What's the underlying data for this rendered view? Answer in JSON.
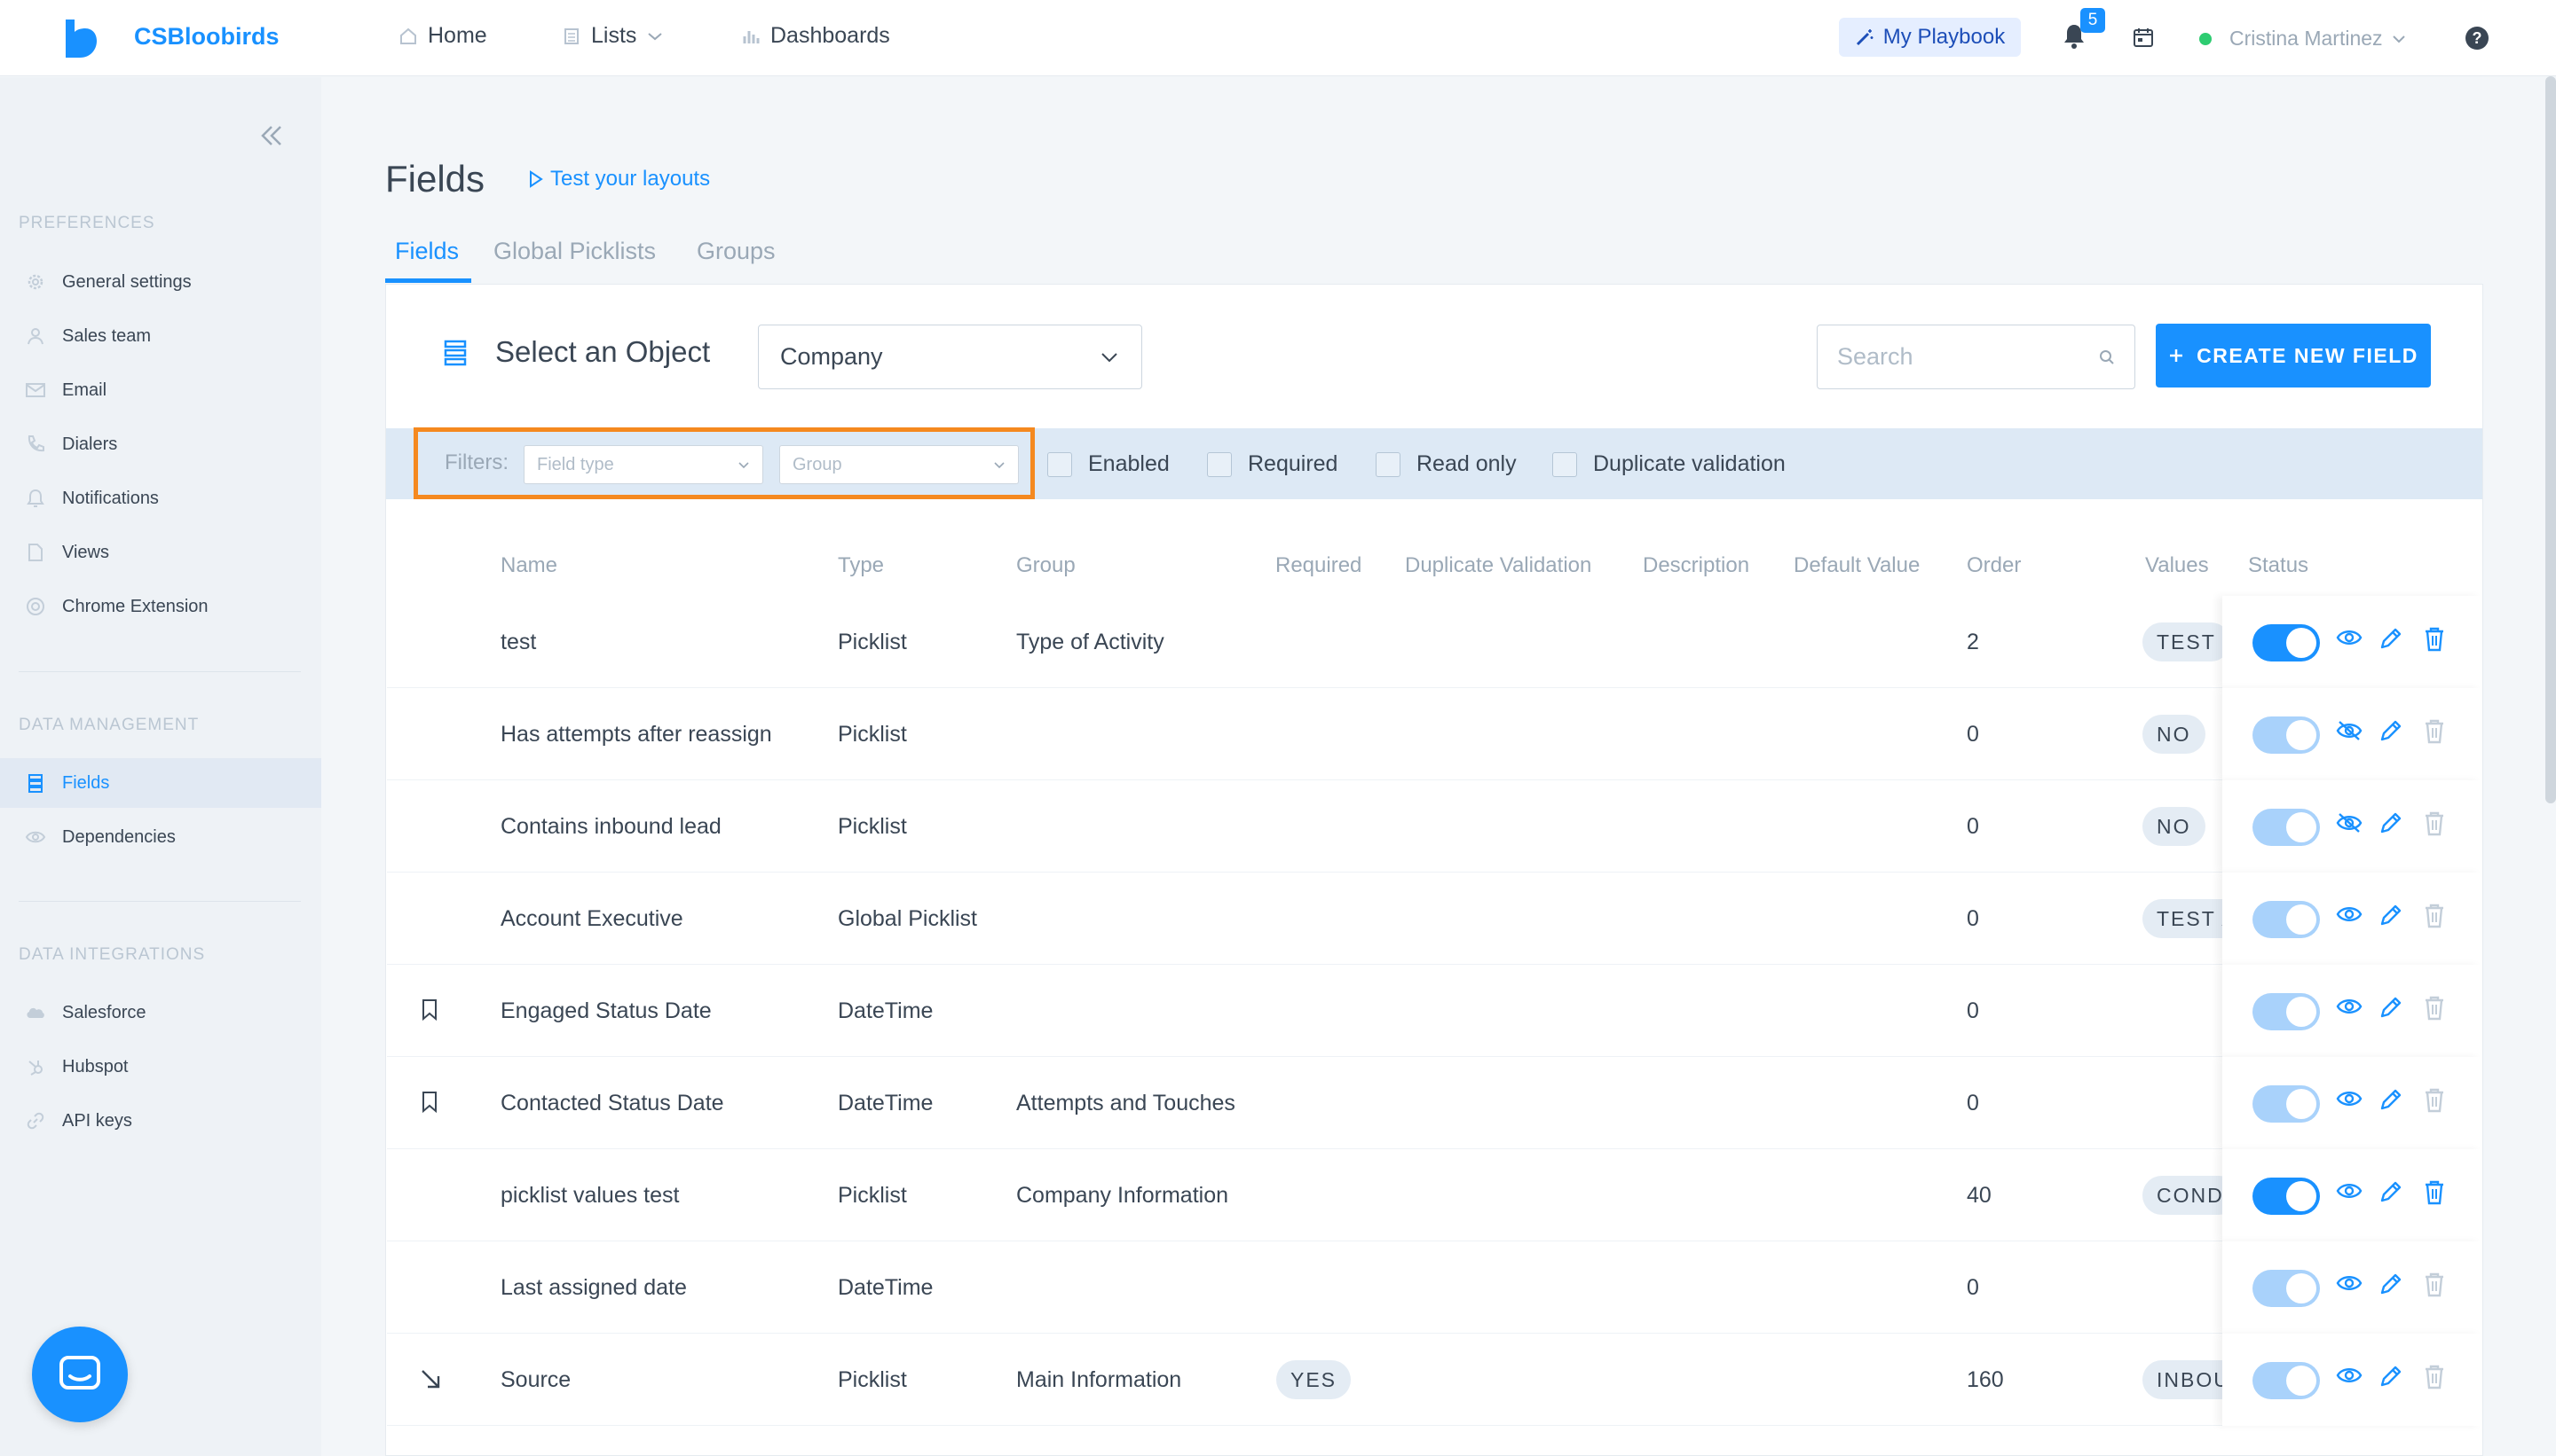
{
  "topbar": {
    "brand": "CSBloobirds",
    "nav": [
      {
        "label": "Home",
        "icon": "home-icon"
      },
      {
        "label": "Lists",
        "icon": "list-icon"
      },
      {
        "label": "Dashboards",
        "icon": "bar-chart-icon"
      }
    ],
    "playbook_label": "My Playbook",
    "notification_count": "5",
    "user_name": "Cristina Martinez"
  },
  "sidebar": {
    "sections": [
      {
        "title": "PREFERENCES",
        "items": [
          "General settings",
          "Sales team",
          "Email",
          "Dialers",
          "Notifications",
          "Views",
          "Chrome Extension"
        ]
      },
      {
        "title": "DATA MANAGEMENT",
        "items": [
          "Fields",
          "Dependencies"
        ]
      },
      {
        "title": "DATA INTEGRATIONS",
        "items": [
          "Salesforce",
          "Hubspot",
          "API keys"
        ]
      }
    ],
    "active_item": "Fields"
  },
  "main": {
    "title": "Fields",
    "test_layouts": "Test your layouts",
    "tabs": [
      "Fields",
      "Global Picklists",
      "Groups"
    ],
    "active_tab": "Fields",
    "select_object_label": "Select an Object",
    "object_value": "Company",
    "search_placeholder": "Search",
    "create_button": "CREATE NEW FIELD",
    "filters": {
      "label": "Filters:",
      "field_type_placeholder": "Field type",
      "group_placeholder": "Group",
      "checkboxes": [
        "Enabled",
        "Required",
        "Read only",
        "Duplicate validation"
      ]
    },
    "columns": [
      "Name",
      "Type",
      "Group",
      "Required",
      "Duplicate Validation",
      "Description",
      "Default Value",
      "Order",
      "Values",
      "Status"
    ],
    "rows": [
      {
        "icon": "",
        "name": "test",
        "type": "Picklist",
        "group": "Type of Activity",
        "required": "",
        "order": "2",
        "values": "TEST",
        "enabled": true,
        "visible": true,
        "deletable": true
      },
      {
        "icon": "",
        "name": "Has attempts after reassign",
        "type": "Picklist",
        "group": "",
        "required": "",
        "order": "0",
        "values": "NO",
        "enabled": false,
        "visible": false,
        "deletable": false
      },
      {
        "icon": "",
        "name": "Contains inbound lead",
        "type": "Picklist",
        "group": "",
        "required": "",
        "order": "0",
        "values": "NO",
        "enabled": false,
        "visible": false,
        "deletable": false
      },
      {
        "icon": "",
        "name": "Account Executive",
        "type": "Global Picklist",
        "group": "",
        "required": "",
        "order": "0",
        "values": "TEST A",
        "enabled": false,
        "visible": true,
        "deletable": false
      },
      {
        "icon": "bookmark-icon",
        "name": "Engaged Status Date",
        "type": "DateTime",
        "group": "",
        "required": "",
        "order": "0",
        "values": "",
        "enabled": false,
        "visible": true,
        "deletable": false
      },
      {
        "icon": "bookmark-icon",
        "name": "Contacted Status Date",
        "type": "DateTime",
        "group": "Attempts and Touches",
        "required": "",
        "order": "0",
        "values": "",
        "enabled": false,
        "visible": true,
        "deletable": false
      },
      {
        "icon": "",
        "name": "picklist values test",
        "type": "Picklist",
        "group": "Company Information",
        "required": "",
        "order": "40",
        "values": "COND",
        "enabled": true,
        "visible": true,
        "deletable": true
      },
      {
        "icon": "",
        "name": "Last assigned date",
        "type": "DateTime",
        "group": "",
        "required": "",
        "order": "0",
        "values": "",
        "enabled": false,
        "visible": true,
        "deletable": false
      },
      {
        "icon": "arrow-down-right-icon",
        "name": "Source",
        "type": "Picklist",
        "group": "Main Information",
        "required": "YES",
        "order": "160",
        "values": "INBOU",
        "enabled": false,
        "visible": true,
        "deletable": false
      }
    ]
  },
  "colors": {
    "accent": "#1991ff",
    "highlight": "#f5891f",
    "online": "#2ecc71"
  }
}
